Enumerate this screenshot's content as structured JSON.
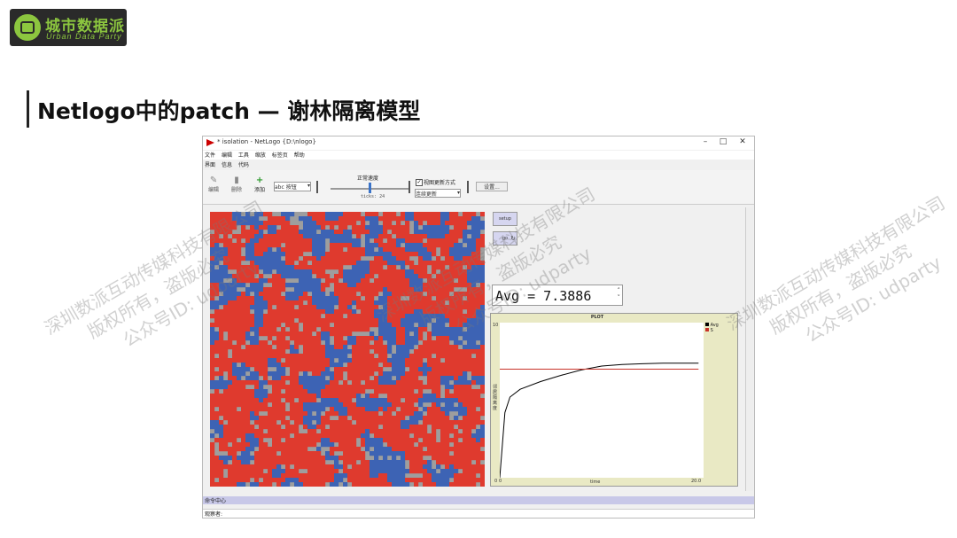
{
  "logo": {
    "cn": "城市数据派",
    "en": "Urban Data Party"
  },
  "slide_title": "Netlogo中的patch — 谢林隔离模型",
  "window": {
    "title": "* isolation - NetLogo {D:\\nlogo}",
    "controls": [
      "–",
      "□",
      "✕"
    ],
    "menu": [
      "文件",
      "编辑",
      "工具",
      "缩放",
      "标签页",
      "帮助"
    ],
    "tabs": [
      "界面",
      "信息",
      "代码"
    ]
  },
  "toolbar": {
    "edit_label": "编辑",
    "delete_label": "删除",
    "add_label": "添加",
    "widget_select": "abc 按钮",
    "speed_label": "正常速度",
    "ticks_text": "ticks: 24",
    "view_update_label": "视图更新方式",
    "update_mode": "连续更新",
    "settings_label": "设置..."
  },
  "buttons": {
    "setup": "setup",
    "go": "go"
  },
  "monitor": {
    "text": "Avg = 7.3886"
  },
  "plot": {
    "title": "PLOT",
    "xmin": "0",
    "xmax": "20.0",
    "ymax": "10",
    "ymin": "0",
    "xlabel": "time",
    "ylabel": "邻居隔离度",
    "legend": [
      "Avg",
      "S"
    ]
  },
  "chart_data": {
    "type": "line",
    "title": "PLOT",
    "xlabel": "time",
    "ylabel": "邻居隔离度",
    "xlim": [
      0,
      20
    ],
    "ylim": [
      0,
      10
    ],
    "series": [
      {
        "name": "Avg",
        "color": "#000000",
        "x": [
          0,
          0.5,
          1,
          2,
          4,
          6,
          8,
          10,
          12,
          14,
          16,
          18,
          19.5
        ],
        "y": [
          0,
          4.2,
          5.2,
          5.7,
          6.2,
          6.6,
          6.95,
          7.2,
          7.3,
          7.35,
          7.38,
          7.39,
          7.39
        ]
      },
      {
        "name": "S",
        "color": "#c83228",
        "x": [
          0,
          19.5
        ],
        "y": [
          7,
          7
        ]
      }
    ]
  },
  "command_center": {
    "label": "命令中心"
  },
  "observer": {
    "label": "观察者:"
  },
  "colors": {
    "red": "#df3a2e",
    "blue": "#3d63b4",
    "gray": "#9e9e9e",
    "logo_green": "#8cc63f"
  },
  "watermark": {
    "line1": "深圳数派互动传媒科技有限公司",
    "line2": "版权所有，盗版必究",
    "line3": "公众号ID: udparty"
  }
}
